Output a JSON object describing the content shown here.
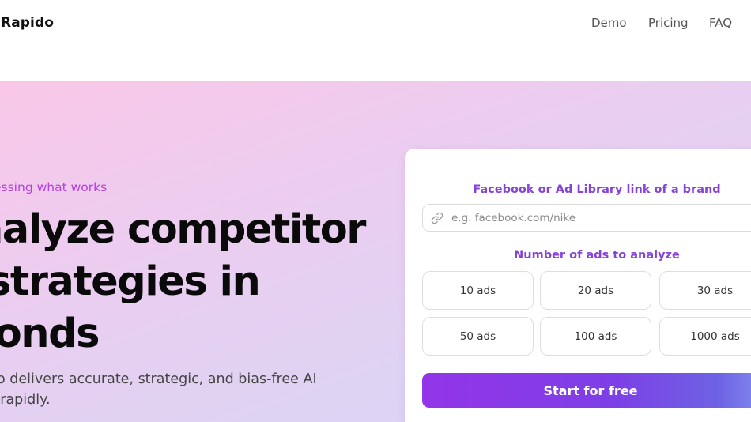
{
  "header": {
    "brand": "Rapido",
    "nav": [
      "Demo",
      "Pricing",
      "FAQ"
    ]
  },
  "hero": {
    "eyebrow": "essing what works",
    "headline_lines": [
      "nalyze competitor",
      "strategies in",
      "conds"
    ],
    "subtitle_lines": [
      "ido delivers accurate, strategic, and bias-free AI",
      "s, rapidly."
    ]
  },
  "form": {
    "link_label": "Facebook or Ad Library link of a brand",
    "link_placeholder": "e.g. facebook.com/nike",
    "link_value": "",
    "ads_label": "Number of ads to analyze",
    "ad_options": [
      "10 ads",
      "20 ads",
      "30 ads",
      "50 ads",
      "100 ads",
      "1000 ads"
    ],
    "submit_label": "Start for free"
  },
  "colors": {
    "accent_purple": "#8743d6",
    "eyebrow_purple": "#b042de",
    "button_gradient_start": "#9335e8",
    "button_gradient_end": "#8590f0"
  },
  "icons": {
    "url_input_icon": "link-icon"
  }
}
